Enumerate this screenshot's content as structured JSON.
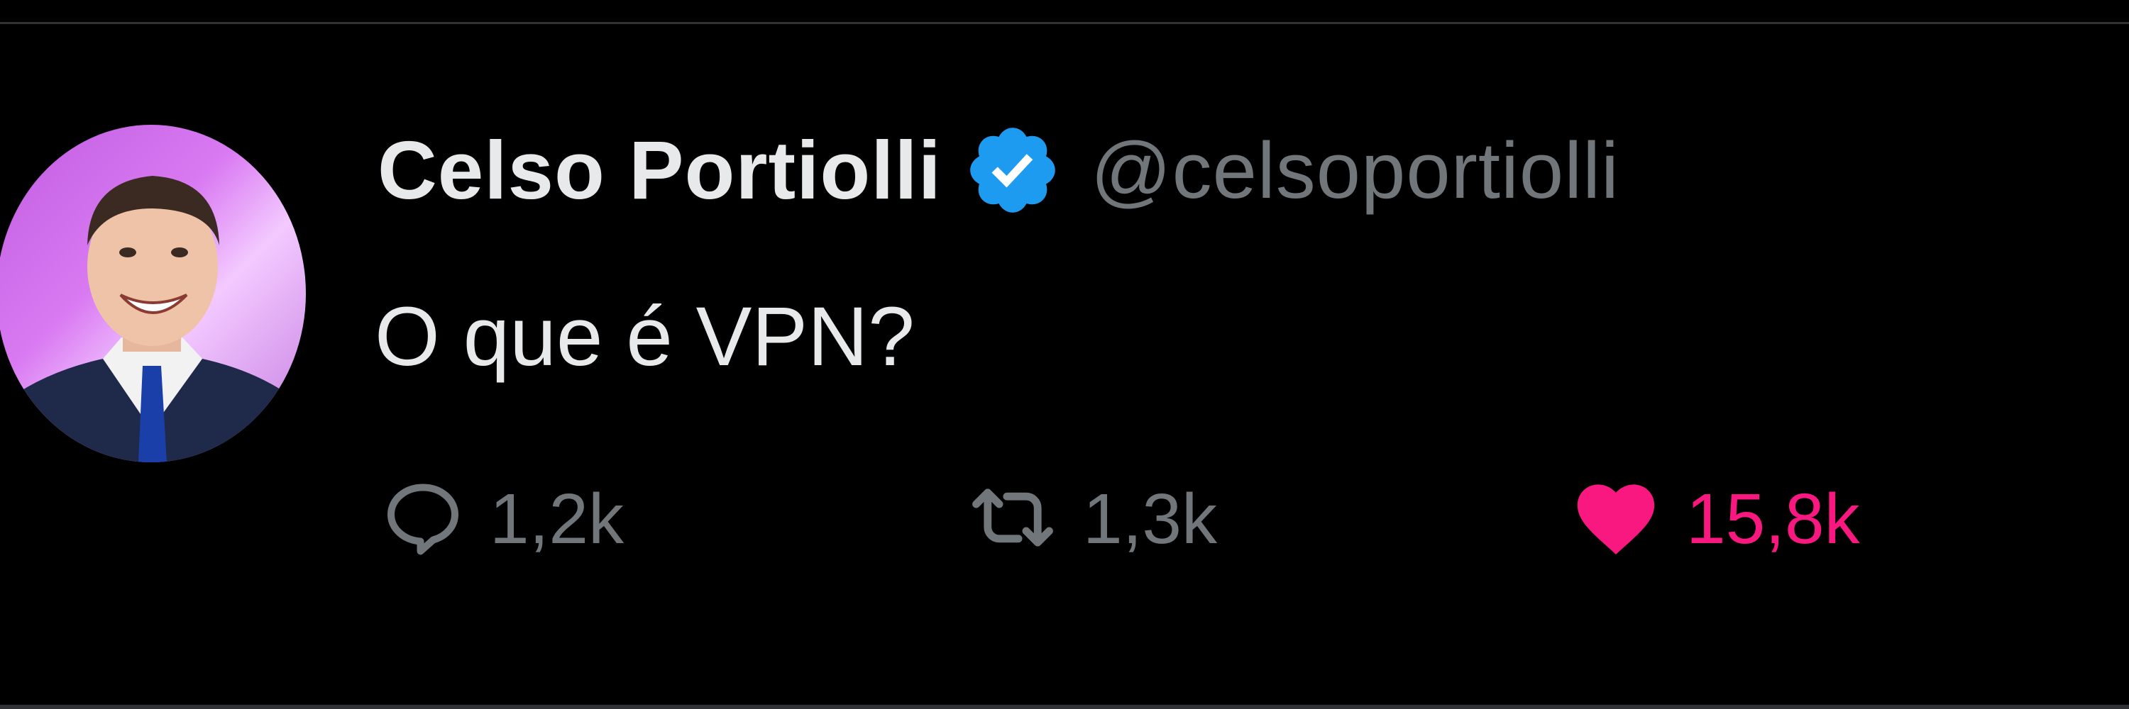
{
  "tweet": {
    "author_name": "Celso Portiolli",
    "handle": "@celsoportiolli",
    "verified": true,
    "text": "O que é VPN?"
  },
  "actions": {
    "reply": {
      "icon": "reply-icon",
      "count": "1,2k"
    },
    "retweet": {
      "icon": "retweet-icon",
      "count": "1,3k"
    },
    "like": {
      "icon": "heart-icon",
      "count": "15,8k",
      "liked": true
    }
  },
  "colors": {
    "background": "#000000",
    "text": "#e7e9ea",
    "secondary": "#71767b",
    "verified": "#1d9bf0",
    "like": "#f91880"
  }
}
